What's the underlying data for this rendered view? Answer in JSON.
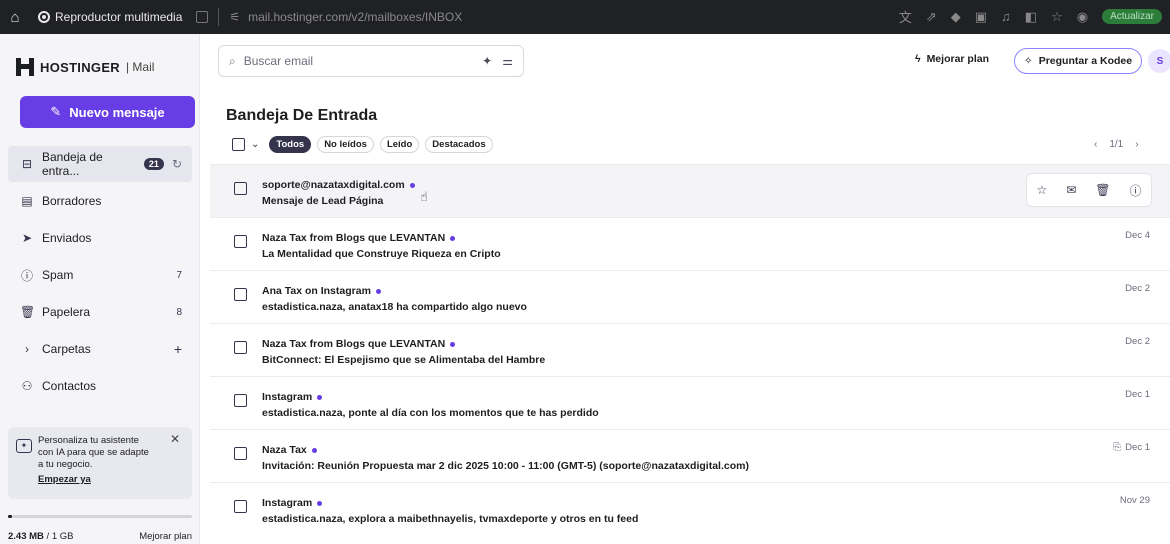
{
  "browser": {
    "tab_title": "Reproductor multimedia",
    "url": "mail.hostinger.com/v2/mailboxes/INBOX",
    "pill": "Actualizar"
  },
  "brand": {
    "name": "HOSTINGER",
    "sub": "| Mail"
  },
  "compose_label": "Nuevo mensaje",
  "nav": [
    {
      "label": "Bandeja de entra...",
      "icon": "inbox-icon",
      "badge": "21",
      "active": true
    },
    {
      "label": "Borradores",
      "icon": "drafts-icon",
      "count": ""
    },
    {
      "label": "Enviados",
      "icon": "sent-icon",
      "count": ""
    },
    {
      "label": "Spam",
      "icon": "spam-icon",
      "count": "7"
    },
    {
      "label": "Papelera",
      "icon": "trash-icon",
      "count": "8"
    },
    {
      "label": "Carpetas",
      "icon": "chevron-right-icon",
      "count": "+"
    },
    {
      "label": "Contactos",
      "icon": "contacts-icon",
      "count": ""
    }
  ],
  "promo": {
    "text": "Personaliza tu asistente con IA para que se adapte a tu negocio.",
    "link": "Empezar ya"
  },
  "storage": {
    "used": "2.43 MB",
    "total": "/ 1 GB",
    "upgrade": "Mejorar plan",
    "fraction": 0.01
  },
  "search": {
    "placeholder": "Buscar email"
  },
  "header": {
    "upgrade_label": "Mejorar plan",
    "ask_label": "Preguntar a Kodee",
    "avatar": "S"
  },
  "inbox": {
    "title": "Bandeja De Entrada",
    "filters": [
      "Todos",
      "No leídos",
      "Leído",
      "Destacados"
    ],
    "pager": "1/1"
  },
  "emails": [
    {
      "sender": "soporte@nazataxdigital.com",
      "subject": "Mensaje de Lead Página",
      "date": "",
      "hover": true,
      "attachment": false
    },
    {
      "sender": "Naza Tax from Blogs que LEVANTAN",
      "subject": "La Mentalidad que Construye Riqueza en Cripto",
      "date": "Dec 4",
      "hover": false,
      "attachment": false
    },
    {
      "sender": "Ana Tax on Instagram",
      "subject": "estadistica.naza, anatax18 ha compartido algo nuevo",
      "date": "Dec 2",
      "hover": false,
      "attachment": false
    },
    {
      "sender": "Naza Tax from Blogs que LEVANTAN",
      "subject": "BitConnect: El Espejismo que se Alimentaba del Hambre",
      "date": "Dec 2",
      "hover": false,
      "attachment": false
    },
    {
      "sender": "Instagram",
      "subject": "estadistica.naza, ponte al día con los momentos que te has perdido",
      "date": "Dec 1",
      "hover": false,
      "attachment": false
    },
    {
      "sender": "Naza Tax",
      "subject": "Invitación: Reunión Propuesta mar 2 dic 2025 10:00 - 11:00 (GMT-5) (soporte@nazataxdigital.com)",
      "date": "Dec 1",
      "hover": false,
      "attachment": true
    },
    {
      "sender": "Instagram",
      "subject": "estadistica.naza, explora a maibethnayelis, tvmaxdeporte y otros en tu feed",
      "date": "Nov 29",
      "hover": false,
      "attachment": false
    }
  ]
}
